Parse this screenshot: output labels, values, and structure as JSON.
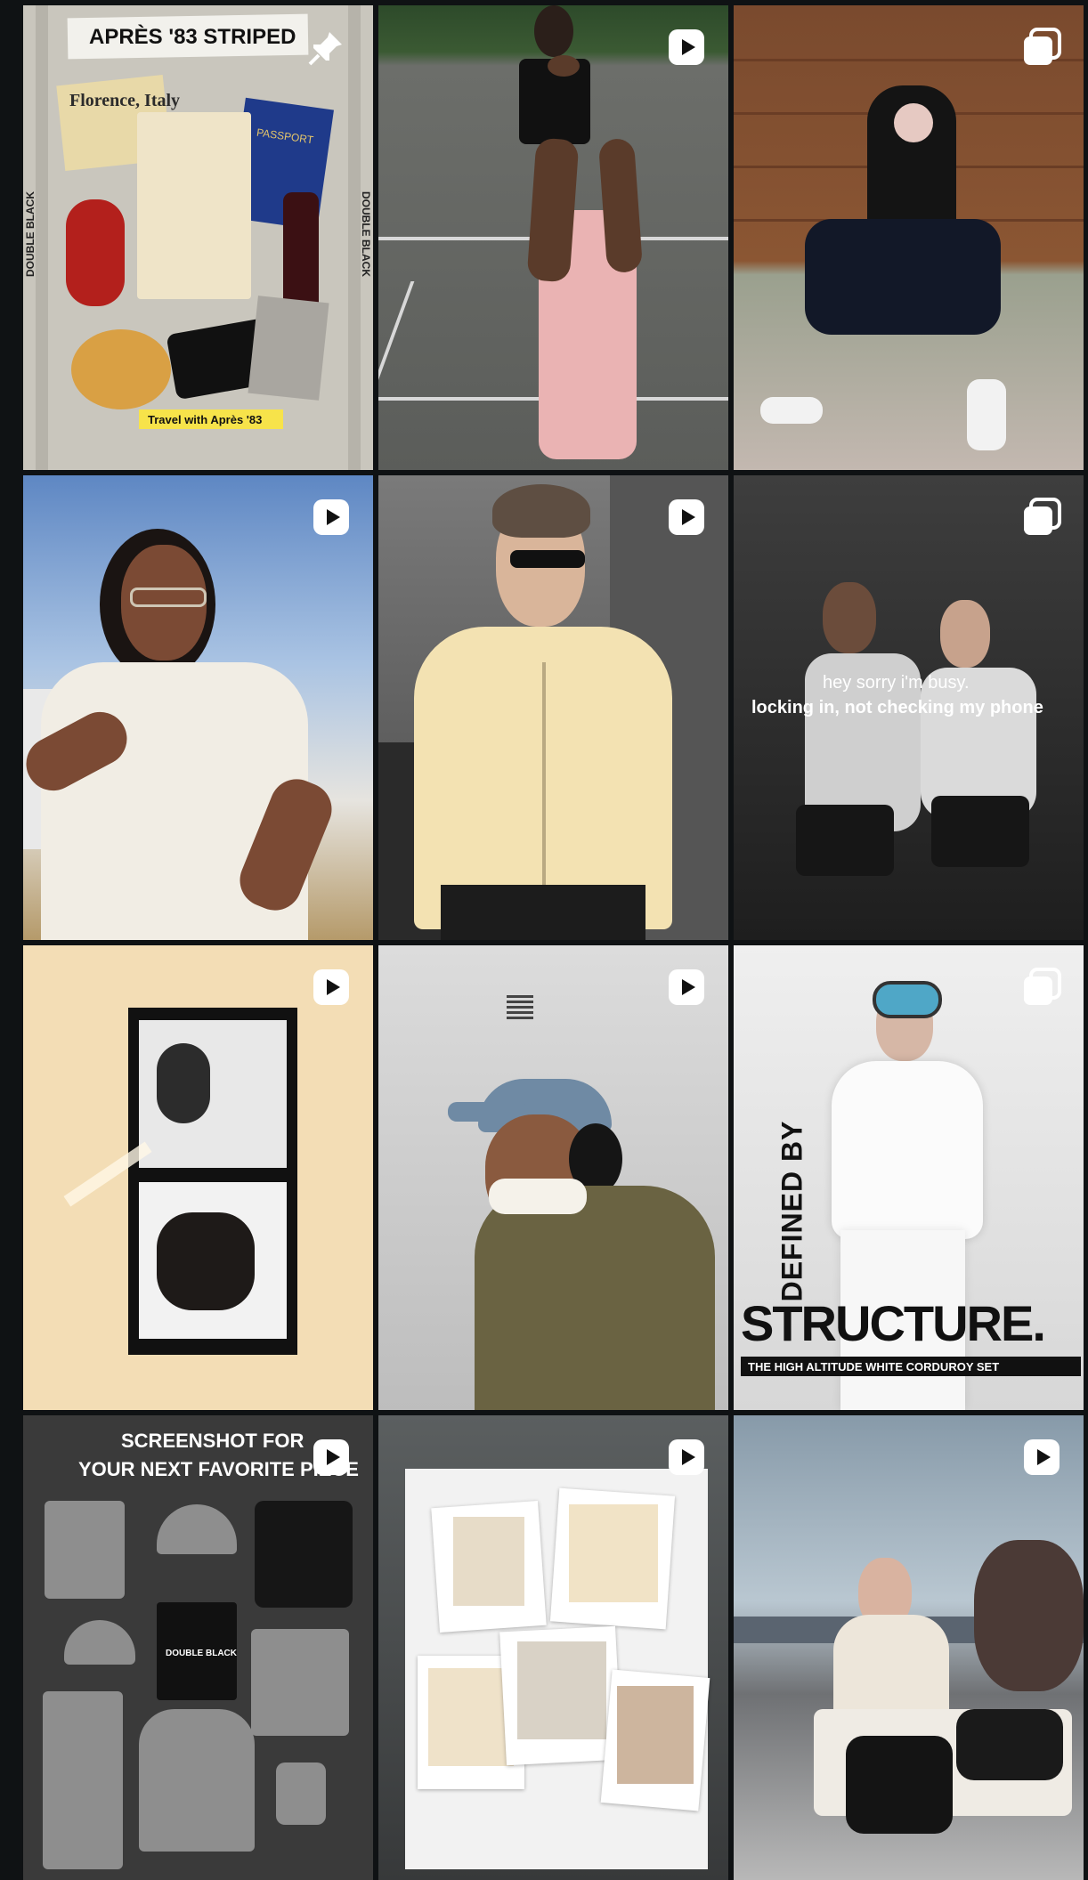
{
  "tiles": [
    {
      "id": "apres-striped",
      "badge": "pin",
      "title": "APRÈS '83 STRIPED",
      "side_text": "DOUBLE BLACK",
      "postcard": "Florence, Italy",
      "passport": "PASSPORT",
      "caption": "Travel with Après '83"
    },
    {
      "id": "pink-cargo",
      "badge": "reel"
    },
    {
      "id": "hoodie-bench",
      "badge": "carousel"
    },
    {
      "id": "selfie-sky",
      "badge": "reel"
    },
    {
      "id": "yellow-track",
      "badge": "reel"
    },
    {
      "id": "busy-couple",
      "badge": "carousel",
      "line1": "hey sorry i'm busy.",
      "line2": "locking in, not checking my phone"
    },
    {
      "id": "film-strip",
      "badge": "reel"
    },
    {
      "id": "cap-jacket",
      "badge": "reel"
    },
    {
      "id": "defined-structure",
      "badge": "carousel",
      "vertical_text": "DEFINED BY",
      "headline": "STRUCTURE.",
      "sub": "THE HIGH ALTITUDE WHITE CORDUROY SET"
    },
    {
      "id": "screenshot-piece",
      "badge": "reel",
      "line1": "SCREENSHOT FOR",
      "line2": "YOUR NEXT FAVORITE PIECE",
      "bag_text": "DOUBLE BLACK"
    },
    {
      "id": "polaroids",
      "badge": "reel"
    },
    {
      "id": "rooftop",
      "badge": "reel"
    }
  ],
  "colors": {
    "page_bg": "#0f1214",
    "badge": "#ffffff",
    "label_yellow": "#f7e34a"
  }
}
